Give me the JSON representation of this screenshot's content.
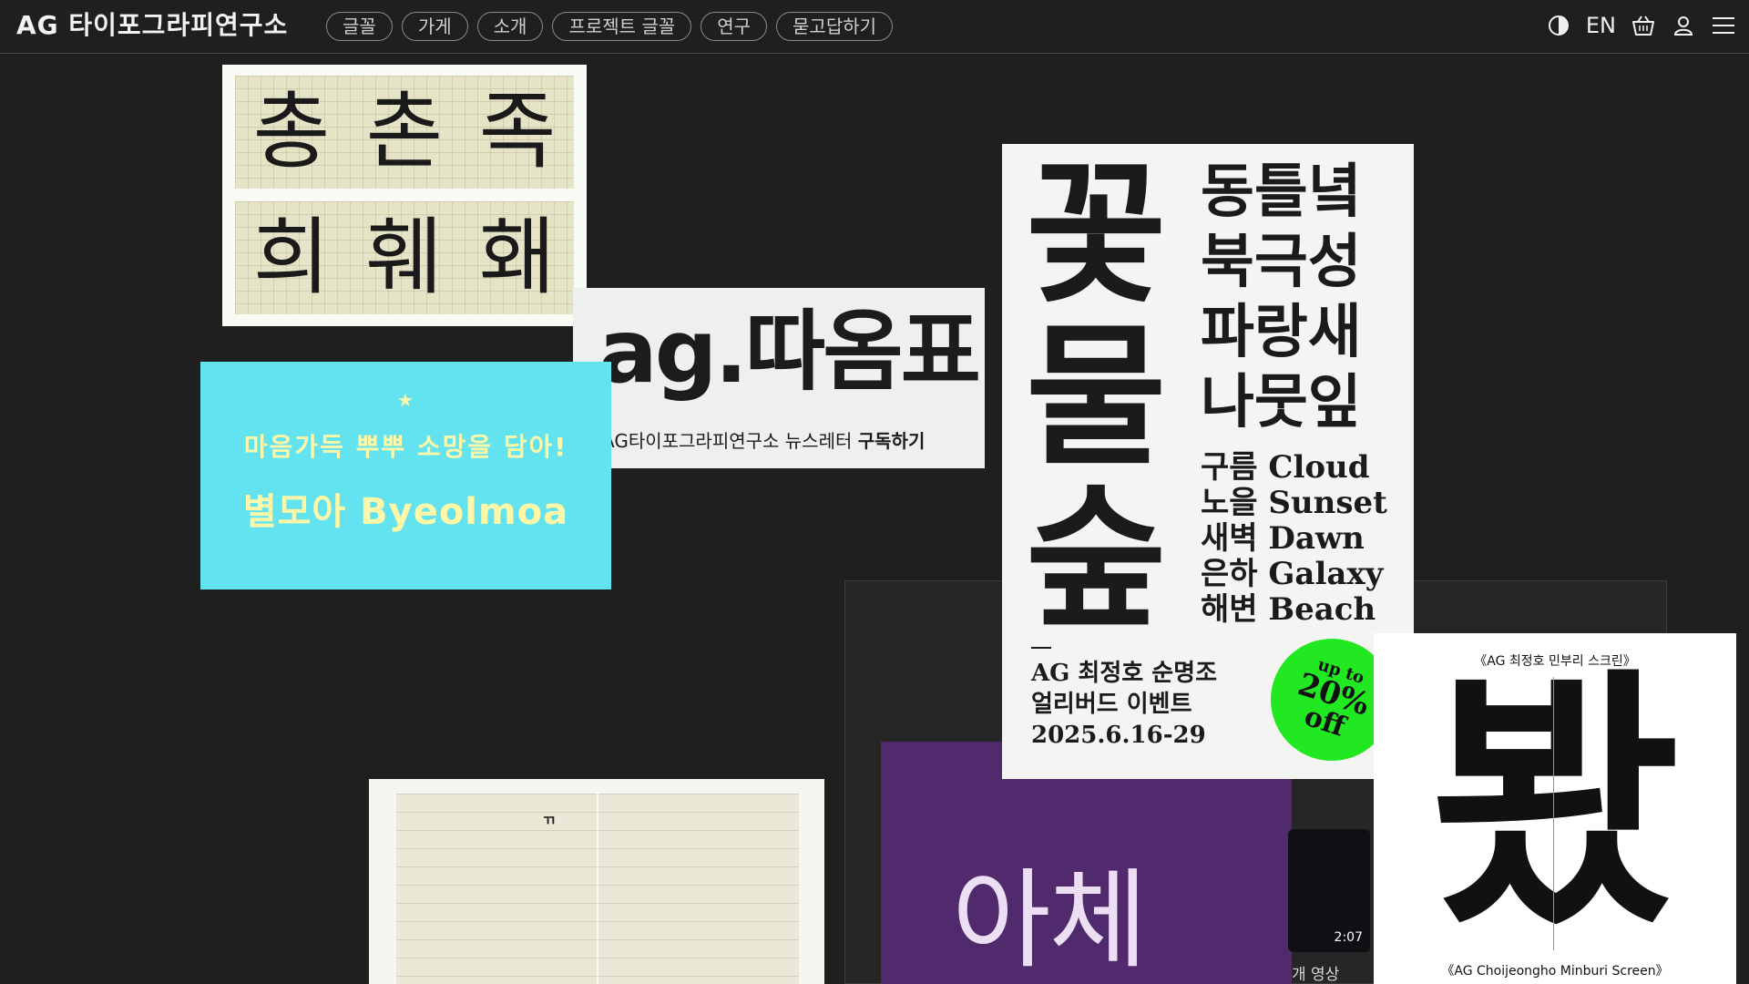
{
  "header": {
    "logo": "AG 타이포그라피연구소",
    "nav": [
      "글꼴",
      "가게",
      "소개",
      "프로젝트 글꼴",
      "연구",
      "묻고답하기"
    ],
    "lang": "EN",
    "icons": [
      "contrast-icon",
      "basket-icon",
      "user-icon",
      "menu-icon"
    ]
  },
  "cards": {
    "grid_sheet": {
      "row1": [
        "총",
        "촌",
        "족"
      ],
      "row2": [
        "희",
        "훼",
        "홰"
      ]
    },
    "newsletter": {
      "logo": "ag.따옴표",
      "text": "AG타이포그라피연구소 뉴스레터",
      "cta": "구독하기"
    },
    "byeolmoa": {
      "line1": "마음가득 뿌뿌 소망을 담아!",
      "line2": "별모아 Byeolmoa"
    },
    "poster": {
      "big": [
        "꽃",
        "물",
        "숲"
      ],
      "words": [
        "동틀녘",
        "북극성",
        "파랑새",
        "나뭇잎"
      ],
      "pairs": [
        "구름 Cloud",
        "노을 Sunset",
        "새벽 Dawn",
        "은하 Galaxy",
        "해변 Beach"
      ],
      "event": [
        "AG 최정호 순명조",
        "얼리버드 이벤트",
        "2025.6.16-29"
      ],
      "badge": [
        "up to",
        "20%",
        "off"
      ]
    },
    "purple": {
      "text": "아체"
    },
    "video": {
      "time": "2:07",
      "caption": "개 영상"
    },
    "minburi": {
      "top": "《AG 최정호 민부리 스크린》",
      "glyph": "봤",
      "bottom": "《AG Choijeongho Minburi Screen》"
    }
  },
  "colors": {
    "background": "#1f1f1f",
    "cyan": "#63e2ef",
    "purple": "#512a6e",
    "badge": "#22e822"
  }
}
